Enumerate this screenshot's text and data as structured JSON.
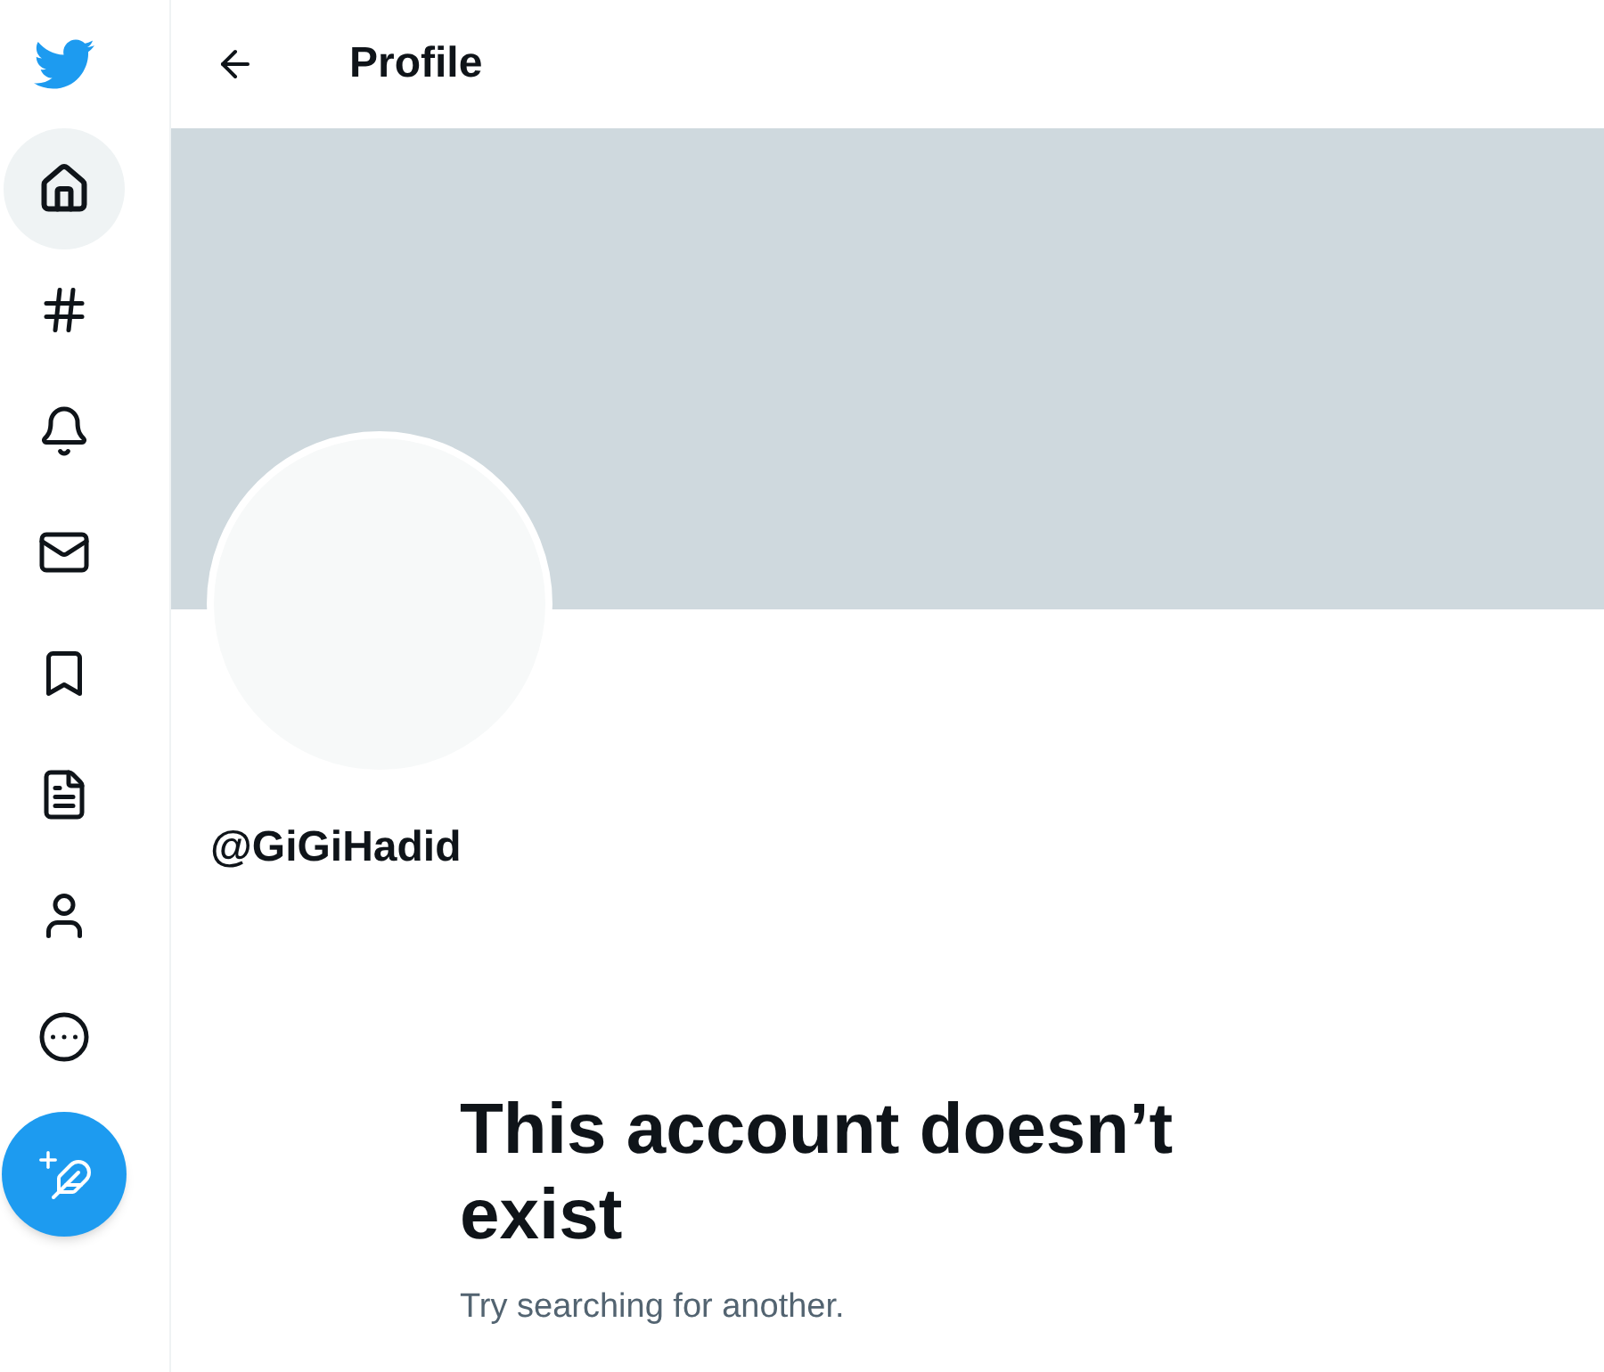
{
  "nav": [
    {
      "kind": "home",
      "selected": true
    },
    {
      "kind": "explore",
      "selected": false
    },
    {
      "kind": "notifications",
      "selected": false
    },
    {
      "kind": "messages",
      "selected": false
    },
    {
      "kind": "bookmarks",
      "selected": false
    },
    {
      "kind": "lists",
      "selected": false
    },
    {
      "kind": "profile",
      "selected": false
    },
    {
      "kind": "more",
      "selected": false
    }
  ],
  "header": {
    "title": "Profile"
  },
  "profile": {
    "handle": "@GiGiHadid"
  },
  "empty_state": {
    "heading": "This account doesn’t exist",
    "message": "Try searching for another."
  }
}
